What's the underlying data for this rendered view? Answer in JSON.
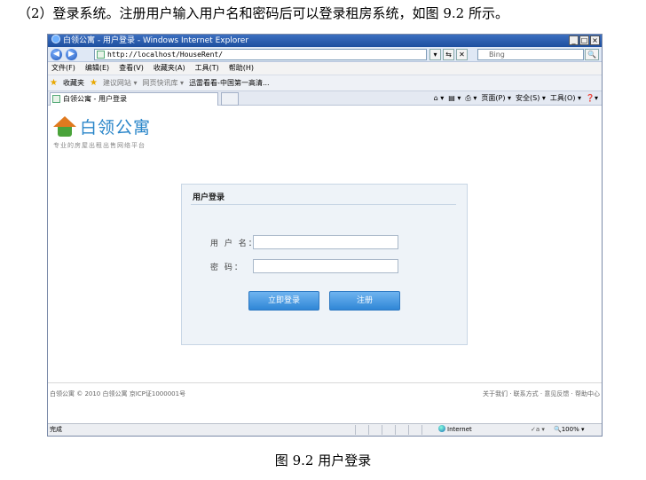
{
  "intro_text": "（2）登录系统。注册用户输入用户名和密码后可以登录租房系统，如图 9.2 所示。",
  "caption": "图 9.2  用户登录",
  "window": {
    "title": "白领公寓 - 用户登录 - Windows Internet Explorer",
    "controls": [
      "_",
      "□",
      "×"
    ]
  },
  "addressbar": {
    "back": "◀",
    "forward": "▶",
    "url": "http://localhost/HouseRent/",
    "buttons": [
      "▾",
      "⇆",
      "✕"
    ],
    "search_placeholder": "Bing",
    "search_button": "🔍"
  },
  "menubar": [
    "文件(F)",
    "编辑(E)",
    "查看(V)",
    "收藏夹(A)",
    "工具(T)",
    "帮助(H)"
  ],
  "favorites": {
    "label": "收藏夹",
    "items": [
      "建议网站 ▾",
      "网页快讯库 ▾",
      "迅雷看看-中国第一高清..."
    ]
  },
  "tab": {
    "title": "白领公寓 - 用户登录"
  },
  "commandbar": [
    "页面(P) ▾",
    "安全(S) ▾",
    "工具(O) ▾"
  ],
  "page": {
    "logo_text": "白领公寓",
    "slogan": "专业的房屋出租出售网络平台",
    "login": {
      "title": "用户登录",
      "username_label": "用 户 名：",
      "password_label": "密    码：",
      "submit_label": "立即登录",
      "register_label": "注册"
    },
    "footer_left": "白领公寓 © 2010 白领公寓 京ICP证1000001号",
    "footer_right": "关于我们 · 联系方式 · 意见反馈 · 帮助中心"
  },
  "statusbar": {
    "status": "完成",
    "zone": "Internet",
    "protected": "✓a ▾",
    "zoom": "🔍100% ▾"
  }
}
